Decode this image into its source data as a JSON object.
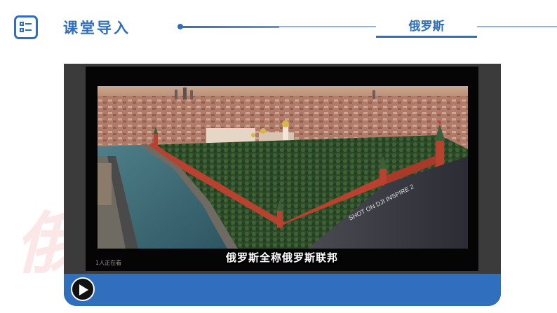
{
  "header": {
    "title": "课堂导入",
    "topic": "俄罗斯"
  },
  "watermark": "俄",
  "video": {
    "subtitle": "俄罗斯全称俄罗斯联邦",
    "overlay_text": "SHOT ON DJI INSPIRE 2",
    "viewer_count": "1人正在看"
  },
  "controls": {
    "play_icon": "play-icon"
  },
  "colors": {
    "accent": "#2f6fbe",
    "kremlin_wall": "#b8412f",
    "river": "#3e6b78"
  }
}
